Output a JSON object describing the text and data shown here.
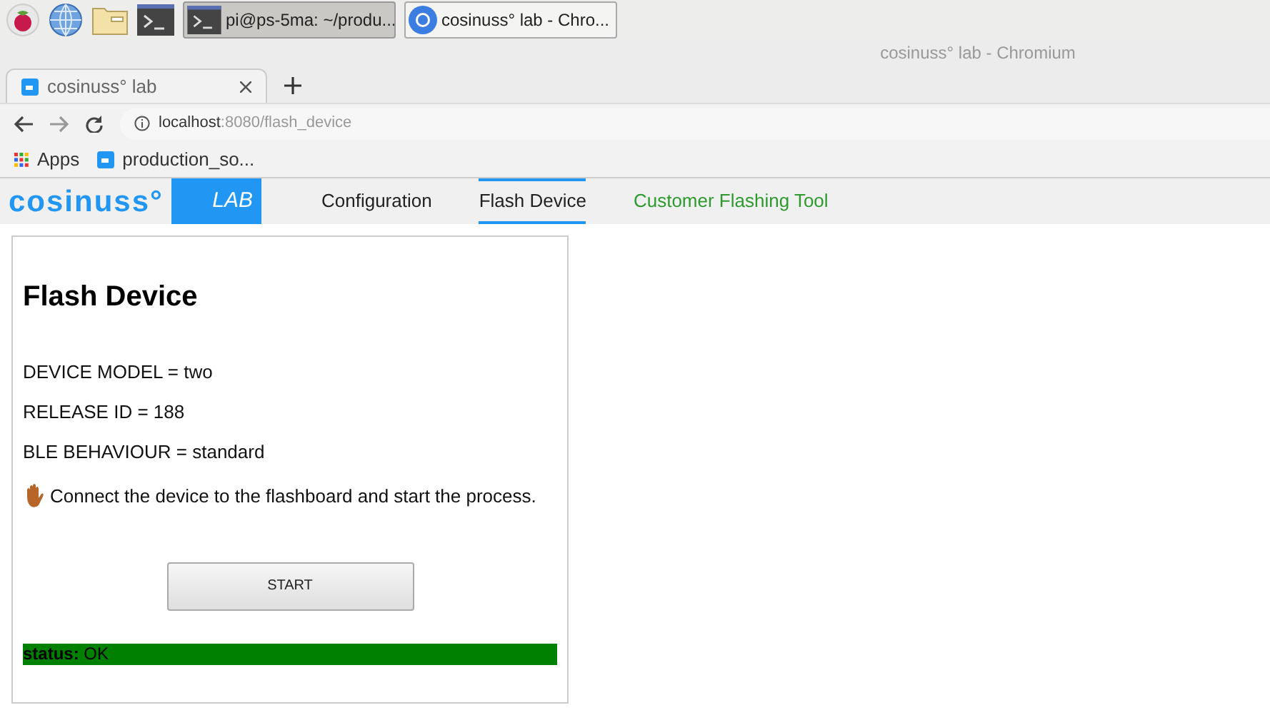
{
  "taskbar": {
    "windows": [
      {
        "label": "pi@ps-5ma: ~/produ...",
        "selected": true,
        "kind": "terminal"
      },
      {
        "label": "cosinuss° lab - Chro...",
        "selected": false,
        "kind": "browser"
      }
    ]
  },
  "window": {
    "title": "cosinuss° lab - Chromium"
  },
  "tabs": [
    {
      "label": "cosinuss° lab",
      "selected": true
    }
  ],
  "address_bar": {
    "host": "localhost",
    "path": ":8080/flash_device"
  },
  "bookmarks": [
    {
      "label": "Apps",
      "kind": "apps"
    },
    {
      "label": "production_so...",
      "kind": "site"
    }
  ],
  "site_nav": {
    "logo": "cosinuss°",
    "lab": "LAB",
    "items": [
      {
        "label": "Configuration",
        "selected": false,
        "kind": "page"
      },
      {
        "label": "Flash Device",
        "selected": true,
        "kind": "page"
      },
      {
        "label": "Customer Flashing Tool",
        "selected": false,
        "kind": "tool"
      }
    ]
  },
  "card": {
    "heading": "Flash Device",
    "fields": [
      "DEVICE MODEL = two",
      "RELEASE ID = 188",
      "BLE BEHAVIOUR = standard"
    ],
    "instruction": "Connect the device to the flashboard and start the process.",
    "button": "START",
    "status": "**status:** OK"
  }
}
